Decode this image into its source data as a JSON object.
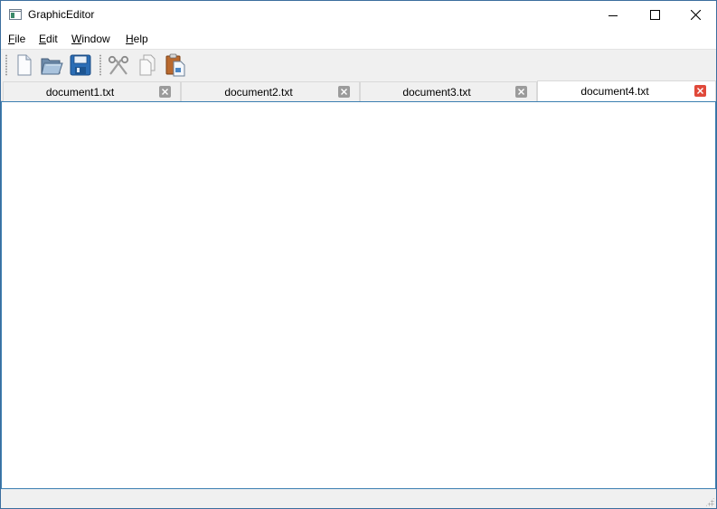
{
  "window": {
    "title": "GraphicEditor"
  },
  "menubar": {
    "items": [
      {
        "mnemonic": "F",
        "rest": "ile"
      },
      {
        "mnemonic": "E",
        "rest": "dit"
      },
      {
        "mnemonic": "W",
        "rest": "indow"
      },
      {
        "mnemonic": "H",
        "rest": "elp"
      }
    ]
  },
  "toolbar": {
    "tools": [
      {
        "icon": "new-document-icon",
        "enabled": true
      },
      {
        "icon": "open-folder-icon",
        "enabled": true
      },
      {
        "icon": "save-floppy-icon",
        "enabled": true
      },
      {
        "icon": "cut-scissors-icon",
        "enabled": false
      },
      {
        "icon": "copy-icon",
        "enabled": false
      },
      {
        "icon": "paste-icon",
        "enabled": true
      }
    ]
  },
  "tabs": [
    {
      "label": "document1.txt",
      "active": false
    },
    {
      "label": "document2.txt",
      "active": false
    },
    {
      "label": "document3.txt",
      "active": false
    },
    {
      "label": "document4.txt",
      "active": true
    }
  ],
  "colors": {
    "active_close": "#e0493a",
    "inactive_close": "#9b9b9b",
    "editor_border": "#3c7fb1"
  }
}
